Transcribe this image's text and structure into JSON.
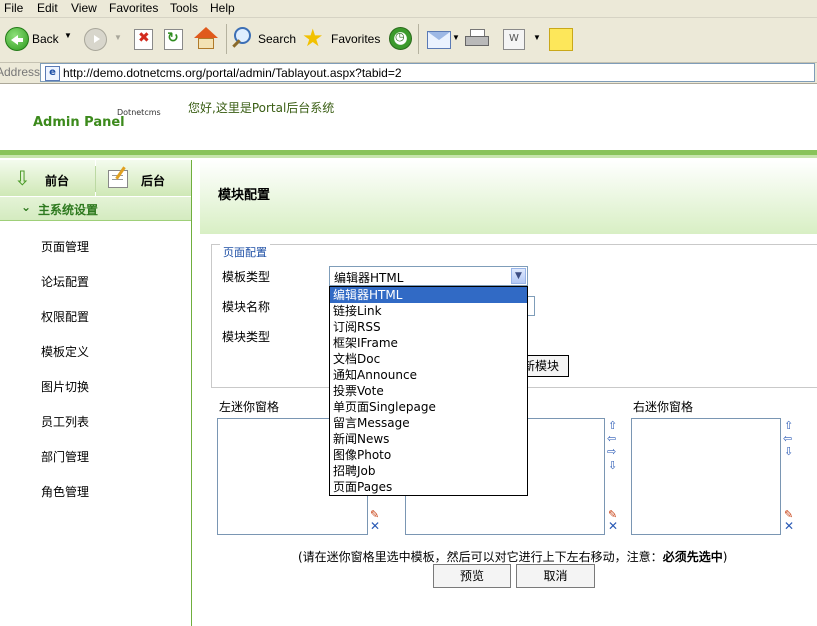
{
  "menu": [
    "File",
    "Edit",
    "View",
    "Favorites",
    "Tools",
    "Help"
  ],
  "toolbar": {
    "back": "Back",
    "search": "Search",
    "favorites": "Favorites"
  },
  "address": {
    "label": "Address",
    "url": "http://demo.dotnetcms.org/portal/admin/Tablayout.aspx?tabid=2"
  },
  "header": {
    "logo_small": "Dotnetcms",
    "logo_main": "Admin Panel",
    "greeting": "您好,这里是Portal后台系统"
  },
  "sidebar": {
    "tabs": [
      "前台",
      "后台"
    ],
    "section": "主系统设置",
    "items": [
      "页面管理",
      "论坛配置",
      "权限配置",
      "模板定义",
      "图片切换",
      "员工列表",
      "部门管理",
      "角色管理"
    ]
  },
  "main": {
    "title": "模块配置",
    "legend": "页面配置",
    "field_template_type": "模板类型",
    "field_module_name": "模块名称",
    "field_module_type": "模块类型",
    "selected": "编辑器HTML",
    "options": [
      "编辑器HTML",
      "链接Link",
      "订阅RSS",
      "框架IFrame",
      "文档Doc",
      "通知Announce",
      "投票Vote",
      "单页面Singlepage",
      "留言Message",
      "新闻News",
      "图像Photo",
      "招聘Job",
      "页面Pages"
    ],
    "new_module_btn": "新模块",
    "left_pane": "左迷你窗格",
    "right_pane": "右迷你窗格",
    "note_prefix": "(请在迷你窗格里选中模板，然后可以对它进行上下左右移动，注意：",
    "note_bold": "必须先选中",
    "note_suffix": ")",
    "preview_btn": "预览",
    "cancel_btn": "取消"
  },
  "colors": {
    "accent_green": "#89c35b",
    "selection_blue": "#316ac5",
    "nav_title": "#2e7a1f"
  }
}
